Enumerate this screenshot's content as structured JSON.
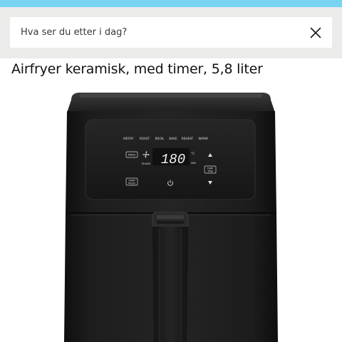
{
  "colors": {
    "accent_strip": "#79d3f2",
    "search_background": "#ebebea",
    "device_body": "#1b1b1b",
    "display_digits": "#f2f2f2"
  },
  "search": {
    "placeholder": "Hva ser du etter i dag?",
    "value": "",
    "clear_icon": "close-icon"
  },
  "product": {
    "title": "Airfryer keramisk, med timer, 5,8 liter",
    "image": {
      "program_labels": [
        "AIRFRY",
        "ROAST",
        "BROIL",
        "BAKE",
        "REHEAT",
        "WARM"
      ],
      "menu_label": "MENU",
      "shake_label": "SHAKE",
      "display_value": "180",
      "unit_label": "°C",
      "min_label": "MIN",
      "temp_time_label_top": "TEMP",
      "temp_time_label_bottom": "TIME",
      "pause_label_top": "START",
      "pause_label_bottom": "PAUSE",
      "power_icon": "power-icon",
      "fan_icon": "fan-icon",
      "up_icon": "triangle-up-icon",
      "down_icon": "triangle-down-icon"
    }
  }
}
